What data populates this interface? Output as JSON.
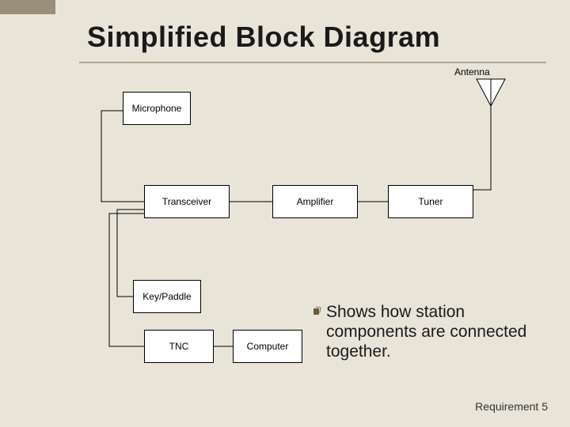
{
  "title": "Simplified Block Diagram",
  "blocks": {
    "microphone": "Microphone",
    "transceiver": "Transceiver",
    "amplifier": "Amplifier",
    "tuner": "Tuner",
    "keypaddle": "Key/Paddle",
    "tnc": "TNC",
    "computer": "Computer",
    "antenna": "Antenna"
  },
  "description": "Shows how station components are connected together.",
  "footer": "Requirement  5"
}
